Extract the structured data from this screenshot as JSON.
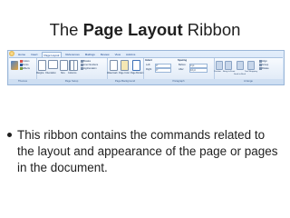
{
  "title": {
    "prefix": "The",
    "bold": "Page Layout",
    "suffix": "Ribbon"
  },
  "ribbon": {
    "tabs": [
      "Home",
      "Insert",
      "Page Layout",
      "References",
      "Mailings",
      "Review",
      "View",
      "Add-Ins"
    ],
    "active_tab": "Page Layout",
    "groups": [
      "Themes",
      "Page Setup",
      "Page Background",
      "Paragraph",
      "Arrange"
    ],
    "themes_items": [
      "Colors",
      "Fonts",
      "Effects"
    ],
    "page_setup_buttons": [
      "Margins",
      "Orientation",
      "Size",
      "Columns"
    ],
    "page_setup_small": [
      "Breaks",
      "Line Numbers",
      "Hyphenation"
    ],
    "background_buttons": [
      "Watermark",
      "Page Color",
      "Page Borders"
    ],
    "indent_label": "Indent",
    "indent_left": "Left:",
    "indent_left_value": "0\"",
    "indent_right": "Right:",
    "indent_right_value": "0\"",
    "spacing_label": "Spacing",
    "spacing_before": "Before:",
    "spacing_before_value": "0 pt",
    "spacing_after": "After:",
    "spacing_after_value": "10 pt",
    "arrange_buttons": [
      "Position",
      "Bring to Front",
      "Send to Back",
      "Text Wrapping",
      "Align",
      "Group",
      "Rotate"
    ]
  },
  "bullet": "This ribbon contains the commands related to the layout and appearance of the page or pages in the document."
}
